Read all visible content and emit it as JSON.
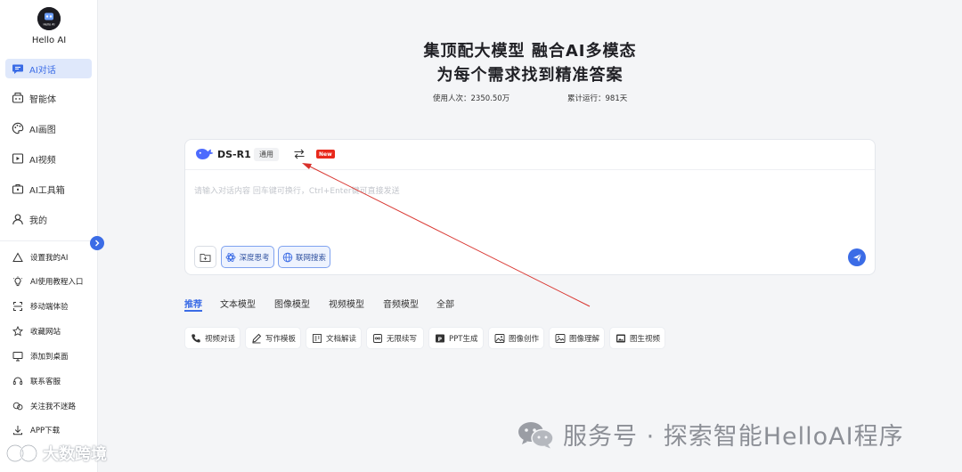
{
  "sidebar": {
    "app_name": "Hello AI",
    "logo_text": "Hello AI",
    "nav": [
      {
        "label": "AI对话",
        "icon": "chat-icon",
        "active": true
      },
      {
        "label": "智能体",
        "icon": "robot-icon"
      },
      {
        "label": "AI画图",
        "icon": "palette-icon"
      },
      {
        "label": "AI视频",
        "icon": "video-icon"
      },
      {
        "label": "AI工具箱",
        "icon": "toolbox-icon"
      },
      {
        "label": "我的",
        "icon": "user-icon"
      }
    ],
    "utilities": [
      {
        "label": "设置我的AI",
        "icon": "triangle-icon"
      },
      {
        "label": "AI使用教程入口",
        "icon": "lightbulb-icon"
      },
      {
        "label": "移动端体验",
        "icon": "mobile-icon"
      },
      {
        "label": "收藏网站",
        "icon": "star-icon"
      },
      {
        "label": "添加到桌面",
        "icon": "monitor-icon"
      },
      {
        "label": "联系客服",
        "icon": "headset-icon"
      },
      {
        "label": "关注我不迷路",
        "icon": "follow-icon"
      },
      {
        "label": "APP下载",
        "icon": "download-icon"
      }
    ]
  },
  "header": {
    "title_line1": "集顶配大模型 融合AI多模态",
    "title_line2": "为每个需求找到精准答案",
    "usage_label": "使用人次：",
    "usage_value": "2350.50万",
    "runtime_label": "累计运行：",
    "runtime_value": "981天"
  },
  "chat": {
    "model_name": "DS-R1",
    "model_tag": "通用",
    "new_badge": "New",
    "placeholder": "请输入对话内容 回车键可换行，Ctrl+Enter键可直接发送",
    "deep_think_label": "深度思考",
    "web_search_label": "联网搜索"
  },
  "categories": [
    "推荐",
    "文本模型",
    "图像模型",
    "视频模型",
    "音频模型",
    "全部"
  ],
  "chips": [
    {
      "label": "视频对话",
      "icon": "phone-icon"
    },
    {
      "label": "写作模板",
      "icon": "pen-icon"
    },
    {
      "label": "文档解读",
      "icon": "document-icon"
    },
    {
      "label": "无限续写",
      "icon": "infinity-icon"
    },
    {
      "label": "PPT生成",
      "icon": "ppt-icon"
    },
    {
      "label": "图像创作",
      "icon": "image-icon"
    },
    {
      "label": "图像理解",
      "icon": "image-scan-icon"
    },
    {
      "label": "图生视频",
      "icon": "image-video-icon"
    }
  ],
  "watermarks": {
    "wechat": "服务号 · 探索智能HelloAI程序",
    "bigdata": "大数跨境"
  },
  "colors": {
    "accent": "#3b6ce6",
    "badge_red": "#e8291c",
    "annotation_red": "#d8312b"
  }
}
